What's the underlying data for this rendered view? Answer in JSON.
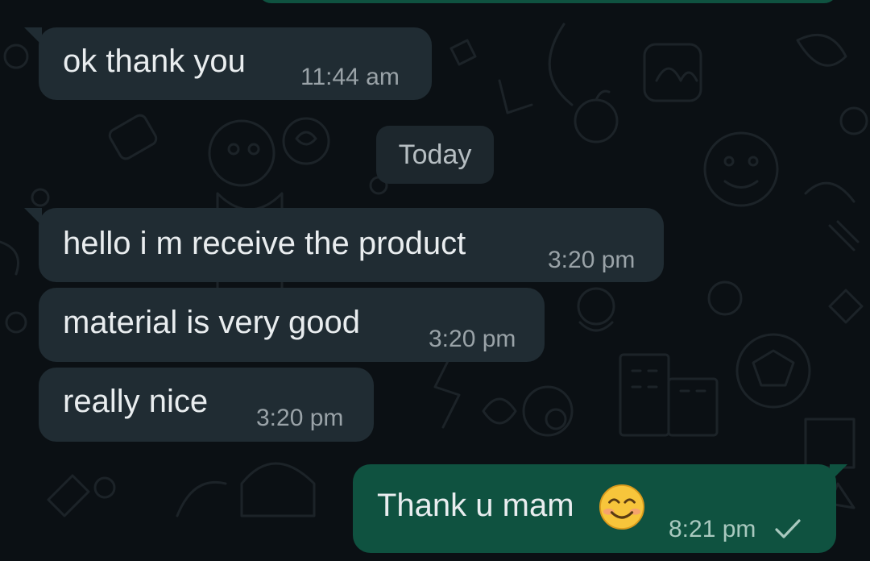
{
  "chat": {
    "date_divider": "Today",
    "messages": [
      {
        "direction": "incoming",
        "text": "ok thank you",
        "time": "11:44 am"
      },
      {
        "direction": "incoming",
        "text": "hello i m receive the product",
        "time": "3:20 pm"
      },
      {
        "direction": "incoming",
        "text": "material is very good",
        "time": "3:20 pm"
      },
      {
        "direction": "incoming",
        "text": "really nice",
        "time": "3:20 pm"
      },
      {
        "direction": "outgoing",
        "text": "Thank u mam",
        "time": "8:21 pm",
        "emoji": "smiling-face-icon",
        "status": "sent-check-icon"
      }
    ]
  },
  "colors": {
    "background": "#0b1014",
    "incoming_bubble": "#202c33",
    "outgoing_bubble": "#0f5240",
    "text": "#e9edef",
    "timestamp": "#9aa3a8"
  }
}
